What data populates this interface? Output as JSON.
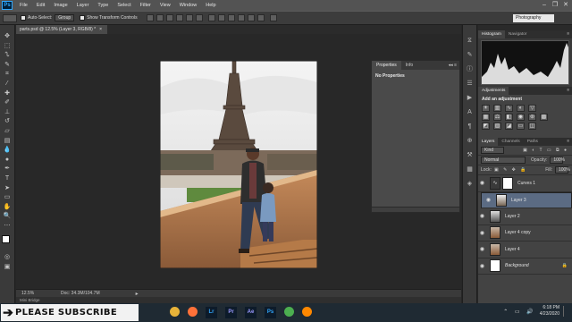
{
  "menubar": {
    "logo": "Ps",
    "items": [
      "File",
      "Edit",
      "Image",
      "Layer",
      "Type",
      "Select",
      "Filter",
      "View",
      "Window",
      "Help"
    ],
    "controls": [
      "minimize-icon",
      "restore-icon",
      "close-icon"
    ]
  },
  "options": {
    "auto_select_label": "Auto-Select:",
    "auto_select_value": "Group",
    "show_transform_label": "Show Transform Controls",
    "workspace": "Photography"
  },
  "document": {
    "tab_title": "parts.psd @ 12.5% (Layer 3, RGB/8) *",
    "zoom": "12.5%",
    "doc_info": "Doc: 34.3M/104.7M"
  },
  "mini_bridge": "Mini Bridge",
  "properties": {
    "tabs": [
      "Properties",
      "Info"
    ],
    "message": "No Properties"
  },
  "histogram": {
    "tabs": [
      "Histogram",
      "Navigator"
    ]
  },
  "adjustments": {
    "tab": "Adjustments",
    "heading": "Add an adjustment",
    "icons": [
      "brightness-icon",
      "levels-icon",
      "curves-icon",
      "exposure-icon",
      "vibrance-icon",
      "hue-sat-icon",
      "color-balance-icon",
      "bw-icon",
      "photo-filter-icon",
      "channel-mixer-icon",
      "color-lookup-icon",
      "invert-icon",
      "posterize-icon",
      "threshold-icon",
      "gradient-map-icon",
      "selective-color-icon"
    ]
  },
  "layers": {
    "tabs": [
      "Layers",
      "Channels",
      "Paths"
    ],
    "kind_filter": "Kind",
    "blend_mode": "Normal",
    "opacity_label": "Opacity:",
    "opacity_value": "100%",
    "lock_label": "Lock:",
    "fill_label": "Fill:",
    "fill_value": "100%",
    "items": [
      {
        "name": "Curves 1",
        "selected": false,
        "italic": false
      },
      {
        "name": "Layer 3",
        "selected": true,
        "italic": false
      },
      {
        "name": "Layer 2",
        "selected": false,
        "italic": false
      },
      {
        "name": "Layer 4 copy",
        "selected": false,
        "italic": false
      },
      {
        "name": "Layer 4",
        "selected": false,
        "italic": false
      },
      {
        "name": "Background",
        "selected": false,
        "italic": true
      }
    ]
  },
  "taskbar": {
    "subscribe_text": "PLEASE SUBSCRIBE",
    "apps": [
      {
        "name": "file-explorer-icon",
        "label": "",
        "color": "#e8b339"
      },
      {
        "name": "firefox-icon",
        "label": "",
        "color": "#ff7139"
      },
      {
        "name": "lightroom-icon",
        "label": "Lr",
        "color": "#31a8ff"
      },
      {
        "name": "premiere-icon",
        "label": "Pr",
        "color": "#9999ff"
      },
      {
        "name": "after-effects-icon",
        "label": "Ae",
        "color": "#9999ff"
      },
      {
        "name": "photoshop-icon",
        "label": "Ps",
        "color": "#31a8ff"
      },
      {
        "name": "chrome-icon",
        "label": "",
        "color": "#4caf50"
      },
      {
        "name": "vlc-icon",
        "label": "",
        "color": "#ff8800"
      }
    ],
    "time": "6:18 PM",
    "date": "4/23/2020"
  }
}
